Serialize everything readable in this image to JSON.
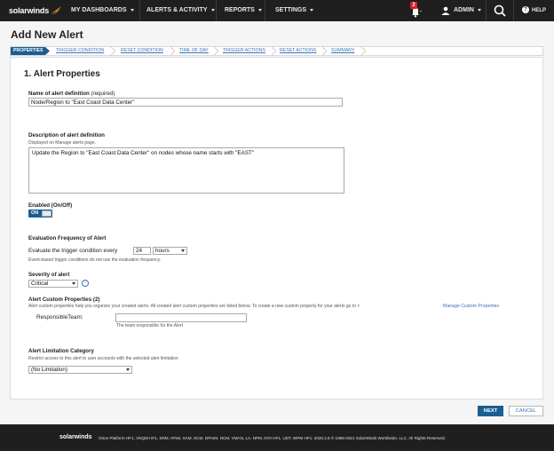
{
  "nav": {
    "logo": "solarwinds",
    "items": [
      "MY DASHBOARDS",
      "ALERTS & ACTIVITY",
      "REPORTS",
      "SETTINGS"
    ],
    "notification_count": "2",
    "user": "ADMIN",
    "help": "HELP"
  },
  "page": {
    "title": "Add New Alert"
  },
  "steps": [
    "PROPERTIES",
    "TRIGGER CONDITION",
    "RESET CONDITION",
    "TIME OF DAY",
    "TRIGGER ACTIONS",
    "RESET ACTIONS",
    "SUMMARY"
  ],
  "form": {
    "section_title": "1. Alert Properties",
    "name_label": "Name of alert definition",
    "name_required": "(required)",
    "name_value": "Node/Region to \"East Coast Data Center\"",
    "desc_label": "Description of alert definition",
    "desc_hint": "Displayed on Manage alerts page.",
    "desc_value": "Update the Region to \"East Coast Data Center\" on nodes whose name starts with \"EAST\"",
    "enabled_label": "Enabled (On/Off)",
    "toggle_label": "ON",
    "eval_label": "Evaluation Frequency of Alert",
    "eval_text": "Evaluate the trigger condition every",
    "eval_value": "24",
    "eval_unit": "hours",
    "eval_hint": "Event-based trigger conditions do not use the evaluation frequency.",
    "severity_label": "Severity of alert",
    "severity_value": "Critical",
    "custom_label": "Alert Custom Properties (2)",
    "custom_hint": "Alert custom properties help you organize your created alerts. All created alert custom properties are listed below. To create a new custom property for your alerts go to >",
    "custom_link": "Manage Custom Properties",
    "team_label": "ResponsibleTeam:",
    "team_value": "",
    "team_hint": "The team responsible for the Alert",
    "limit_label": "Alert Limitation Category",
    "limit_hint": "Restrict access to this alert to user accounts with the selected alert limitation",
    "limit_value": "(No Limitation)"
  },
  "buttons": {
    "next": "NEXT",
    "cancel": "CANCEL"
  },
  "footer": {
    "logo": "solarwinds",
    "text": "Orion Platform HF1, VNQM HF1, SRM, IPAM, SAM, SCM, DPAIM, NCM, VMAN, LA, NPM, NTA HF1, UDT, WPM HF1: 2020.2.6 © 1999-2021 SolarWinds Worldwide, LLC. All Rights Reserved."
  },
  "colors": {
    "accent": "#1a5e93",
    "link": "#3a73b8",
    "nav_bg": "#1f1f1f",
    "badge": "#d62222",
    "logo_orange": "#f7941d"
  }
}
